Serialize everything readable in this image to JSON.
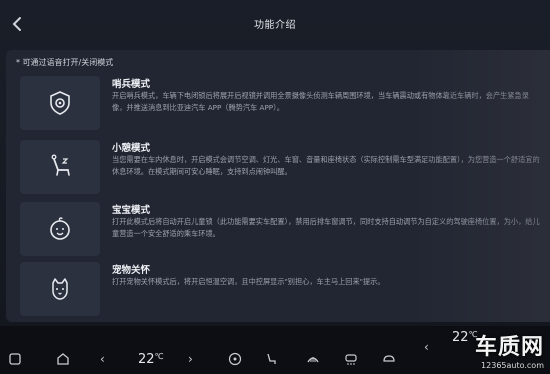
{
  "header": {
    "back_icon": "chevron-left-icon",
    "title": "功能介绍"
  },
  "section_note": "* 可通过语音打开/关闭模式",
  "modes": [
    {
      "name": "哨兵模式",
      "icon": "sentry-camera-icon",
      "desc": "开启哨兵模式，车辆下电闭锁后将展开后视镜并调用全景摄像头侦测车辆周围环境，当车辆震动或有物体靠近车辆时，会产生紧急录像，并推送消息到比亚迪汽车 APP（腾势汽车 APP）。"
    },
    {
      "name": "小憩模式",
      "icon": "recline-seat-icon",
      "desc": "当您需要在车内休息时，开启模式会调节空调、灯光、车窗、音量和座椅状态（实际控制需车型满足功能配置），为您营造一个舒适宜的休息环境。在模式期间可安心睡眠，支持到点闹钟叫醒。"
    },
    {
      "name": "宝宝模式",
      "icon": "baby-face-icon",
      "desc": "打开此模式后将自动开启儿童锁（此功能需要实车配置），禁用后排车窗调节，同时支持自动调节为自定义的驾驶座椅位置，为小，给儿童营造一个安全舒适的乘车环境。"
    },
    {
      "name": "宠物关怀",
      "icon": "pet-dog-icon",
      "desc": "打开宠物关怀模式后，将开启恒温空调，且中控屏显示\"别担心，车主马上回来\"提示。"
    }
  ],
  "bottom_bar": {
    "temp_left": "22",
    "temp_right": "22",
    "temp_unit": "℃",
    "temp_right_unit": "℃"
  },
  "watermark": {
    "main": "车质网",
    "sub": "12365auto.com"
  }
}
